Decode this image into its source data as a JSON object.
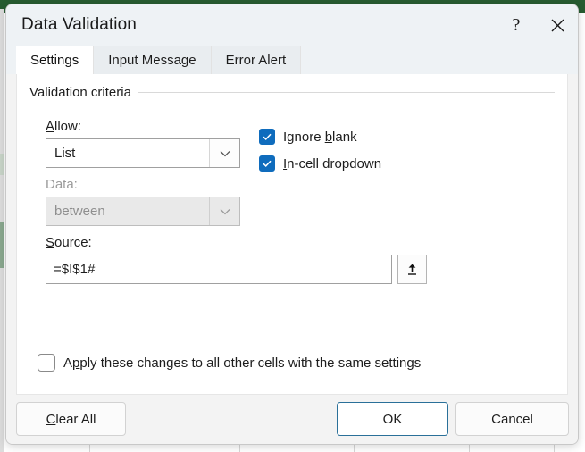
{
  "window": {
    "title": "Data Validation",
    "help_icon": "question-mark-icon",
    "close_icon": "close-icon"
  },
  "tabs": [
    {
      "id": "settings",
      "label": "Settings",
      "active": true
    },
    {
      "id": "input-message",
      "label": "Input Message",
      "active": false
    },
    {
      "id": "error-alert",
      "label": "Error Alert",
      "active": false
    }
  ],
  "settings": {
    "group_title": "Validation criteria",
    "allow": {
      "label": "Allow:",
      "accel": "A",
      "value": "List",
      "enabled": true,
      "arrow_icon": "chevron-down-icon"
    },
    "data": {
      "label": "Data:",
      "value": "between",
      "enabled": false,
      "arrow_icon": "chevron-down-icon"
    },
    "source": {
      "label": "Source:",
      "accel": "S",
      "value": "=$I$1#",
      "placeholder": "",
      "picker_icon": "collapse-dialog-arrow-icon"
    },
    "ignore_blank": {
      "label": "Ignore blank",
      "accel": "b",
      "checked": true
    },
    "in_cell_dropdown": {
      "label": "In-cell dropdown",
      "accel": "I",
      "checked": true
    },
    "apply_all": {
      "label": "Apply these changes to all other cells with the same settings",
      "accel": "p",
      "checked": false
    }
  },
  "footer": {
    "clear_all": {
      "label": "Clear All",
      "accel": "C"
    },
    "ok": {
      "label": "OK",
      "is_default": true
    },
    "cancel": {
      "label": "Cancel"
    }
  },
  "colors": {
    "accent_checkbox": "#0f6cbd",
    "default_button_border": "#2a7099",
    "titlebar_bg": "#eef2f5",
    "dialog_bg": "#f3f3f3",
    "content_bg": "#ffffff",
    "backdrop_green": "#275c31"
  }
}
